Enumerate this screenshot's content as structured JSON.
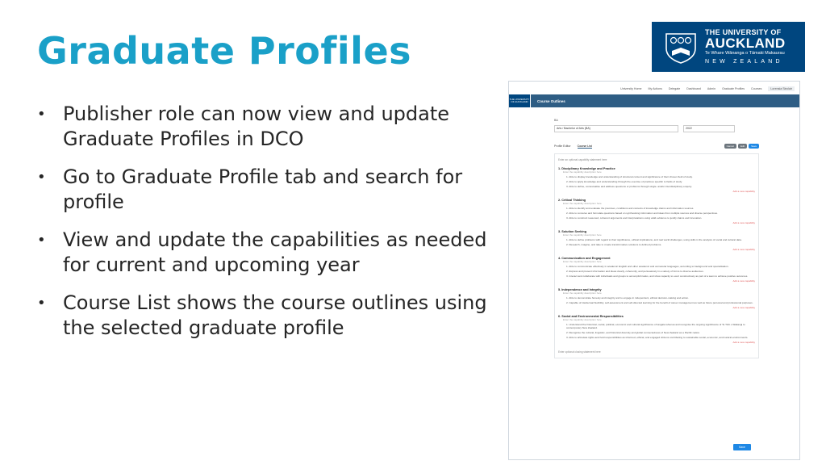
{
  "slide": {
    "title": "Graduate Profiles",
    "bullets": [
      "Publisher role can now view and update Graduate Profiles in DCO",
      "Go to Graduate Profile tab and search for profile",
      "View and update the capabilities as needed for current and upcoming year",
      "Course List shows the course outlines using the selected graduate profile"
    ],
    "bullet_glyph": "•"
  },
  "logo": {
    "line1": "THE UNIVERSITY OF",
    "line2": "AUCKLAND",
    "line3": "Te Whare Wānanga o Tāmaki Makaurau",
    "line4": "NEW ZEALAND",
    "color": "#00467f"
  },
  "app": {
    "nav": [
      "University Home",
      "My Actions",
      "Delegate",
      "Dashboard",
      "Admin",
      "Graduate Profiles",
      "Courses"
    ],
    "user": "Lorensia Sinclair",
    "minilogo": "THE UNIVERSITY OF AUCKLAND",
    "section_title": "Course Outlines",
    "field_label": "BA",
    "program_select": "Arts / Bachelor of Arts (BA)",
    "year_select": "2022",
    "tabs": [
      "Profile Editor",
      "Course List"
    ],
    "buttons": [
      "Cancel",
      "Edit",
      "Save"
    ],
    "hint_top": "Enter an optional capability statement here",
    "hint_bottom": "Enter optional closing statement here",
    "add_label": "Add a new capability",
    "save_label": "Save",
    "sections": [
      {
        "title": "1. Disciplinary Knowledge and Practice",
        "sub": "Enter the capability description here",
        "caps": [
          "1. Able to display knowledge and understanding of structural content and significance of their chosen field of study.",
          "2. Able to apply knowledge and understanding through the exercise of practices specific to fields of study.",
          "3. Able to define, contextualise and address questions or problems through single- and/or interdisciplinary enquiry."
        ]
      },
      {
        "title": "2. Critical Thinking",
        "sub": "Enter the capability description here",
        "caps": [
          "1. Able to identify and evaluate the premises, conditions and contexts of knowledge claims and information sources.",
          "2. Able to conceive and formulate questions based on synthesising information and ideas from multiple sources and diverse perspectives.",
          "3. Able to construct reasoned, coherent arguments and interpretations using valid evidence to justify claims and innovation."
        ]
      },
      {
        "title": "3. Solution Seeking",
        "sub": "Enter the capability description here",
        "caps": [
          "1. Able to define problems with regard to their significance, ethical implications, and real world challenges, using skills in the analysis of social and cultural data.",
          "2. Research, imagine, and take to create transformative solutions to defined problems."
        ]
      },
      {
        "title": "4. Communication and Engagement",
        "sub": "Enter the capability description here",
        "caps": [
          "1. Able to communicate effectively in academic English and other academic and vernacular languages, according to background and specialisation.",
          "2. Express and present information and ideas clearly, coherently, and persuasively in a variety of forms to diverse audiences.",
          "3. Interact and collaborate with individuals and groups to accomplish tasks, and show capacity to exert constructively as part of a team to achieve positive outcomes."
        ]
      },
      {
        "title": "5. Independence and Integrity",
        "sub": "Enter the capability description here",
        "caps": [
          "1. Able to demonstrate honesty and integrity and to engage in independent, ethical decision-making and action.",
          "2. Capable of intellectual flexibility, self-assessment and self-directed learning for the benefit of career management as well as future personal and professional purposes."
        ]
      },
      {
        "title": "6. Social and Environmental Responsibilities",
        "sub": "Enter the capability description here",
        "caps": [
          "1. Understand the historical, social, political, economic and cultural significance of tangata whenua and recognise the ongoing significance of Te Tiriti o Waitangi to contemporary New Zealand.",
          "2. Recognise the cultural, linguistic, and historical diversity and global connectedness of New Zealand as a Pacific nation.",
          "3. Able to articulate rights and hold responsibilities as informed, ethical, and engaged citizens contributing to sustainable social, economic, and natural environments."
        ]
      }
    ]
  }
}
